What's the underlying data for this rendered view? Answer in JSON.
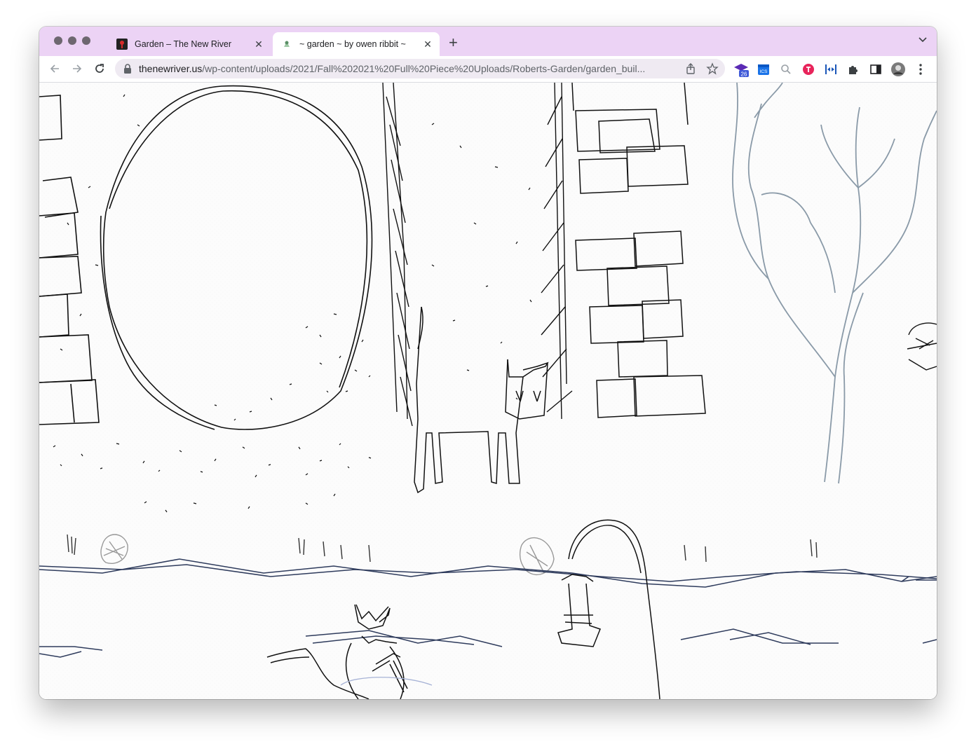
{
  "browser": {
    "tabs": [
      {
        "title": "Garden – The New River",
        "active": false
      },
      {
        "title": "~ garden ~ by owen ribbit ~",
        "active": true
      }
    ],
    "address": {
      "domain": "thenewriver.us",
      "path": "/wp-content/uploads/2021/Fall%202021%20Full%20Piece%20Uploads/Roberts-Garden/garden_buil..."
    },
    "extension_badge": "26",
    "extension_ics_label": "ICS"
  },
  "colors": {
    "tabbar_bg": "#ecd3f5",
    "ink": "#111111",
    "tree": "#8a9aa8",
    "river": "#2e3b5c"
  },
  "icons": [
    "back-icon",
    "forward-icon",
    "reload-icon",
    "lock-icon",
    "share-icon",
    "star-icon",
    "graduation-cap-icon",
    "calendar-icon",
    "magnifier-icon",
    "extension-icon",
    "split-icon",
    "puzzle-icon",
    "sidebar-icon",
    "avatar",
    "more-icon"
  ]
}
